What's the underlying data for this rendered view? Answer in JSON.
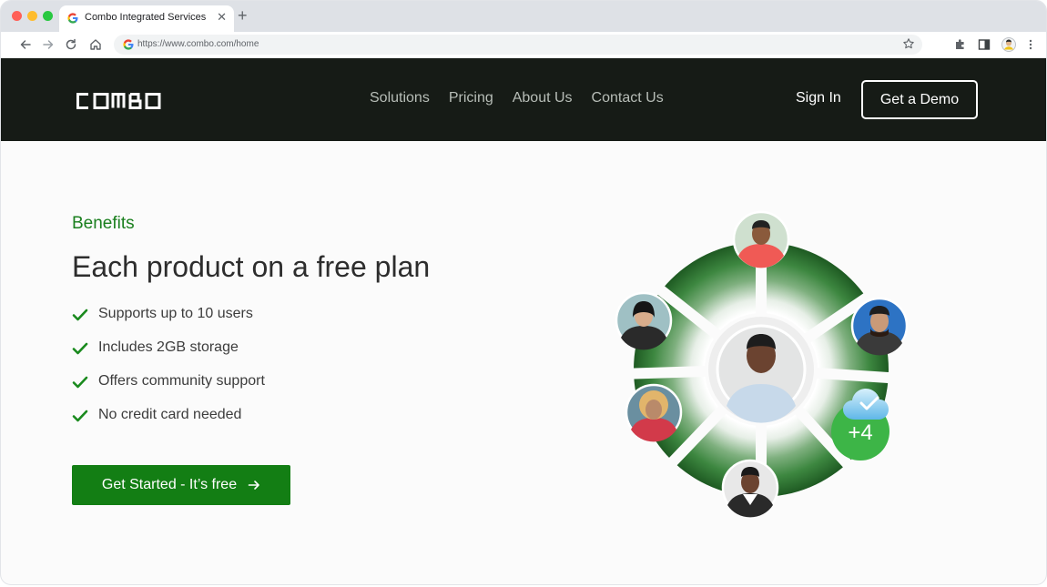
{
  "browser": {
    "tab_title": "Combo Integrated Services",
    "url": "https://www.combo.com/home"
  },
  "site": {
    "logo_text": "COMBO",
    "nav": [
      "Solutions",
      "Pricing",
      "About Us",
      "Contact Us"
    ],
    "sign_in": "Sign In",
    "demo_button": "Get a Demo"
  },
  "hero": {
    "eyebrow": "Benefits",
    "headline": "Each product on a free plan",
    "benefits": [
      "Supports up to 10 users",
      "Includes 2GB storage",
      "Offers community support",
      "No credit card needed"
    ],
    "cta": "Get Started - It’s free",
    "extra_users_badge": "+4"
  },
  "colors": {
    "nav_bg": "#161b16",
    "accent_green": "#137e14",
    "eyebrow_green": "#1a7f1e",
    "badge_green": "#3db547"
  }
}
